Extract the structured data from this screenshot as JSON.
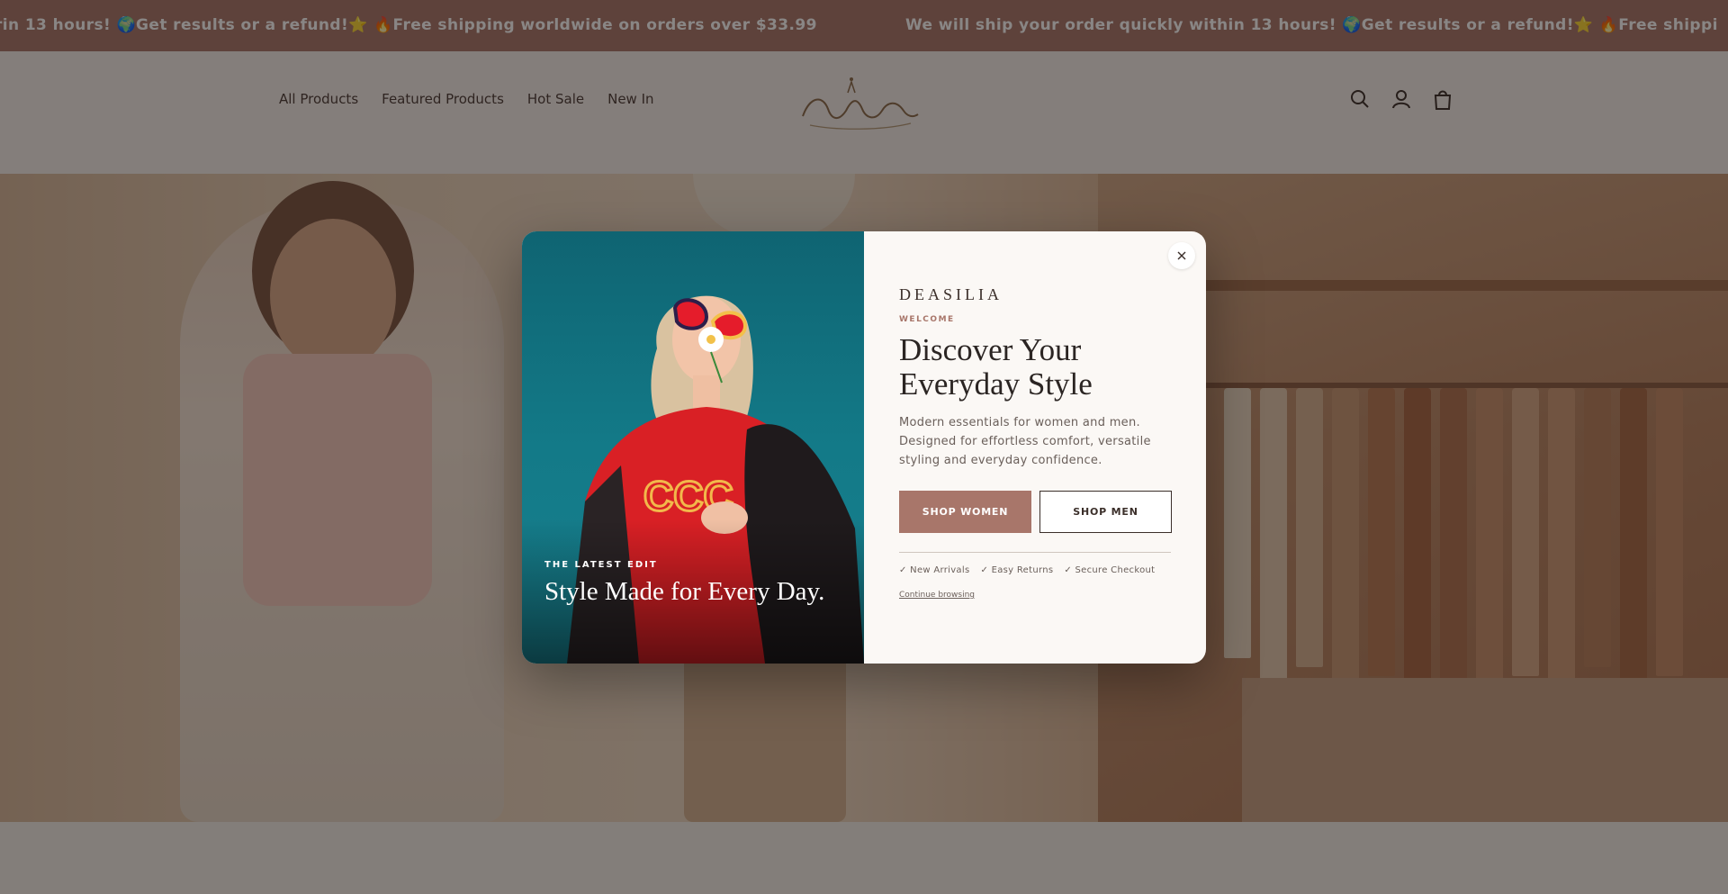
{
  "announcement": {
    "segment_a": "rin 13 hours! 🌍Get results or a refund!⭐️ 🔥Free shipping worldwide on orders over $33.99",
    "segment_b": "We will ship your order quickly within 13 hours! 🌍Get results or a refund!⭐️ 🔥Free shippi"
  },
  "nav": {
    "items": [
      {
        "label": "All Products"
      },
      {
        "label": "Featured Products"
      },
      {
        "label": "Hot Sale"
      },
      {
        "label": "New In"
      }
    ]
  },
  "header_icons": [
    "search-icon",
    "account-icon",
    "cart-icon"
  ],
  "modal": {
    "media": {
      "kicker": "THE LATEST EDIT",
      "title": "Style Made for Every Day."
    },
    "brand": "DEASILIA",
    "eyebrow": "WELCOME",
    "headline": "Discover Your Everyday Style",
    "description": "Modern essentials for women and men. Designed for effortless comfort, versatile styling and everyday confidence.",
    "cta_primary": "SHOP WOMEN",
    "cta_secondary": "SHOP MEN",
    "perks": [
      "✓ New Arrivals",
      "✓ Easy Returns",
      "✓ Secure Checkout"
    ],
    "continue_label": "Continue browsing",
    "close_symbol": "×"
  },
  "colors": {
    "accent": "#a8766a",
    "announcement_bg": "#a8766a",
    "modal_bg": "#fbf8f5",
    "media_bg": "#137a88"
  }
}
